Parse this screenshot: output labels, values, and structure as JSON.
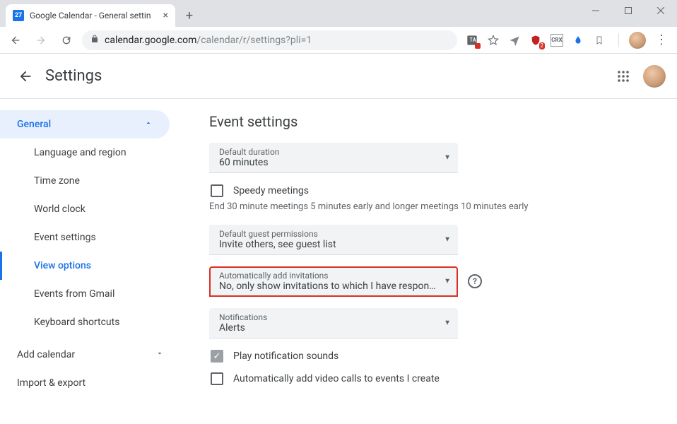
{
  "browser": {
    "tab": {
      "favicon_day": "27",
      "title": "Google Calendar - General settin"
    },
    "url_host": "calendar.google.com",
    "url_path": "/calendar/r/settings?pli=1",
    "ext_badge": "2"
  },
  "header": {
    "title": "Settings"
  },
  "sidebar": {
    "section": "General",
    "items": [
      {
        "label": "Language and region",
        "active": false
      },
      {
        "label": "Time zone",
        "active": false
      },
      {
        "label": "World clock",
        "active": false
      },
      {
        "label": "Event settings",
        "active": false
      },
      {
        "label": "View options",
        "active": true
      },
      {
        "label": "Events from Gmail",
        "active": false
      },
      {
        "label": "Keyboard shortcuts",
        "active": false
      }
    ],
    "add_calendar": "Add calendar",
    "import_export": "Import & export"
  },
  "main": {
    "section_title": "Event settings",
    "default_duration": {
      "label": "Default duration",
      "value": "60 minutes"
    },
    "speedy": {
      "label": "Speedy meetings",
      "checked": false
    },
    "speedy_helper": "End 30 minute meetings 5 minutes early and longer meetings 10 minutes early",
    "guest_perms": {
      "label": "Default guest permissions",
      "value": "Invite others, see guest list"
    },
    "auto_inv": {
      "label": "Automatically add invitations",
      "value": "No, only show invitations to which I have respond…"
    },
    "notifications": {
      "label": "Notifications",
      "value": "Alerts"
    },
    "play_sounds": {
      "label": "Play notification sounds",
      "checked": true
    },
    "auto_video": {
      "label": "Automatically add video calls to events I create",
      "checked": false
    }
  }
}
